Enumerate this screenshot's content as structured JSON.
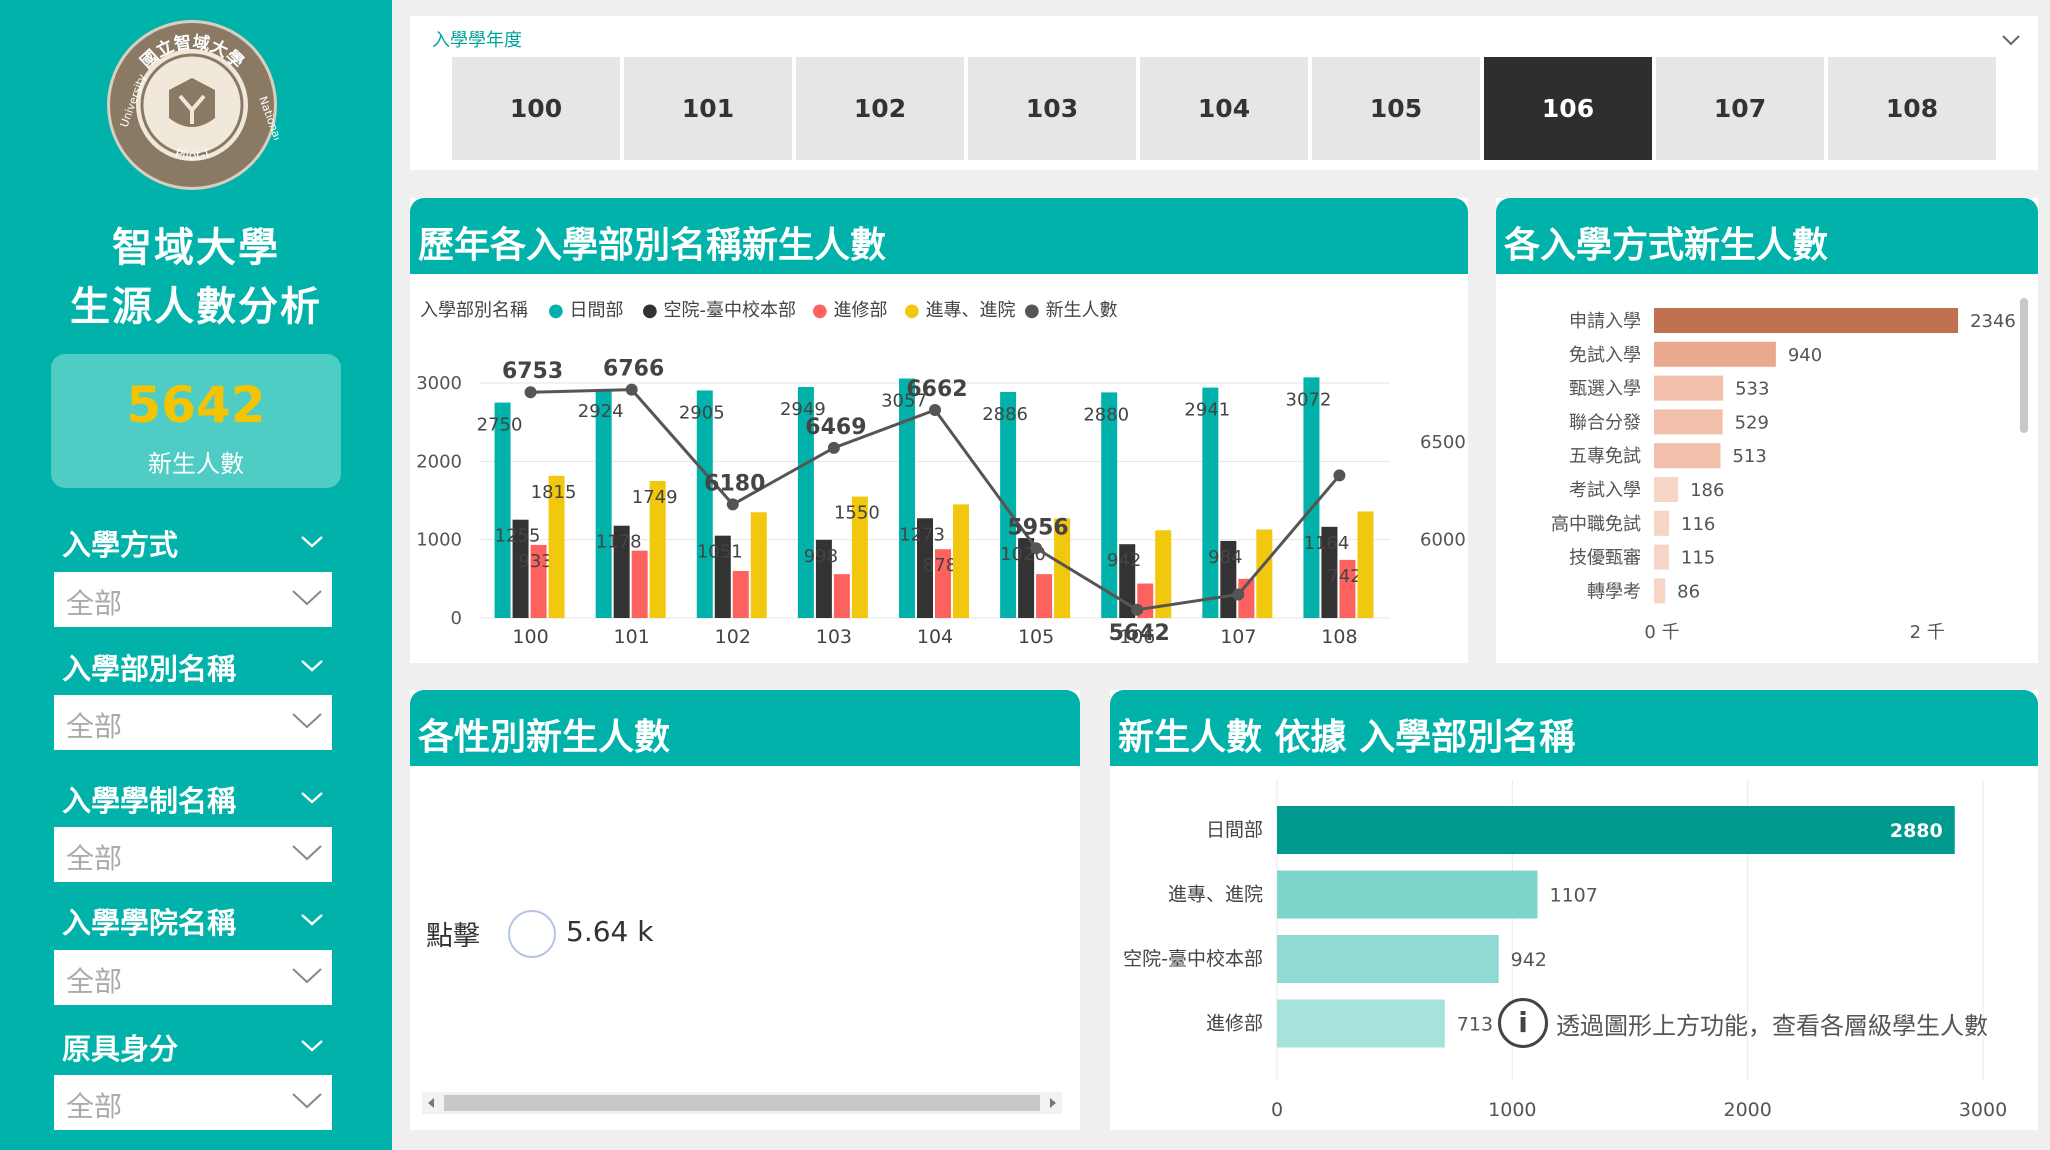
{
  "sidebar": {
    "logo": {
      "text_top": "國立智域大學",
      "text_right": "National",
      "text_left": "University",
      "text_bottom": "Pilot-I"
    },
    "title_line1": "智域大學",
    "title_line2": "生源人數分析",
    "kpi": {
      "value": "5642",
      "label": "新生人數"
    },
    "slicers": [
      {
        "label": "入學方式",
        "value": "全部"
      },
      {
        "label": "入學部別名稱",
        "value": "全部"
      },
      {
        "label": "入學學制名稱",
        "value": "全部"
      },
      {
        "label": "入學學院名稱",
        "value": "全部"
      },
      {
        "label": "原具身分",
        "value": "全部"
      }
    ],
    "colors": {
      "bg": "#00b2a9",
      "kpi_bg": "#4fcdc5",
      "kpi_value": "#f5c400"
    }
  },
  "year_slicer": {
    "label": "入學學年度",
    "years": [
      "100",
      "101",
      "102",
      "103",
      "104",
      "105",
      "106",
      "107",
      "108"
    ],
    "selected": "106"
  },
  "combo_chart": {
    "title": "歷年各入學部別名稱新生人數",
    "legend_title": "入學部別名稱",
    "legend": [
      {
        "name": "日間部",
        "color": "#00b2a9"
      },
      {
        "name": "空院-臺中校本部",
        "color": "#333333"
      },
      {
        "name": "進修部",
        "color": "#fd625e"
      },
      {
        "name": "進專、進院",
        "color": "#f2c80f"
      },
      {
        "name": "新生人數",
        "color": "#555555"
      }
    ],
    "x_labels": [
      "100",
      "101",
      "102",
      "103",
      "104",
      "105",
      "106",
      "107",
      "108"
    ],
    "left_ticks": [
      "0",
      "1000",
      "2000",
      "3000"
    ],
    "right_ticks": [
      "6000",
      "6500"
    ]
  },
  "chart_data": [
    {
      "type": "bar+line",
      "title": "歷年各入學部別名稱新生人數",
      "categories": [
        "100",
        "101",
        "102",
        "103",
        "104",
        "105",
        "106",
        "107",
        "108"
      ],
      "series": [
        {
          "name": "日間部",
          "values": [
            2750,
            2924,
            2905,
            2949,
            3057,
            2886,
            2880,
            2941,
            3072
          ]
        },
        {
          "name": "空院-臺中校本部",
          "values": [
            1255,
            1178,
            1051,
            998,
            1273,
            1020,
            942,
            984,
            1164
          ]
        },
        {
          "name": "進修部",
          "values": [
            933,
            860,
            600,
            560,
            878,
            560,
            440,
            500,
            742
          ]
        },
        {
          "name": "進專、進院",
          "values": [
            1815,
            1749,
            1350,
            1550,
            1450,
            1270,
            1120,
            1130,
            1360
          ]
        },
        {
          "name": "新生人數",
          "axis": "right",
          "values": [
            6753,
            6766,
            6180,
            6469,
            6662,
            5956,
            5642,
            5720,
            6328
          ]
        }
      ],
      "labeled_values": {
        "日間部": [
          "2750",
          "2924",
          "2905",
          "2949",
          "3057",
          "2886",
          "2880",
          "2941",
          "3072"
        ],
        "空院-臺中校本部": [
          "1255",
          "1178",
          "1051",
          "998",
          "1273",
          "1020",
          "942",
          "984",
          "1164"
        ],
        "進修部": [
          "933",
          "",
          "",
          "",
          "878",
          "",
          "",
          "",
          "742"
        ],
        "進專、進院": [
          "1815",
          "1749",
          "",
          "1550",
          "",
          "",
          "",
          "",
          ""
        ],
        "新生人數": [
          "6753",
          "6766",
          "6180",
          "6469",
          "6662",
          "5956",
          "5642",
          "",
          ""
        ]
      },
      "ylim": [
        0,
        3000
      ],
      "y2lim": [
        5600,
        6800
      ]
    },
    {
      "type": "bar",
      "orientation": "horizontal",
      "title": "各入學方式新生人數",
      "categories": [
        "申請入學",
        "免試入學",
        "甄選入學",
        "聯合分發",
        "五專免試",
        "考試入學",
        "高中職免試",
        "技優甄審",
        "轉學考"
      ],
      "values": [
        2346,
        940,
        533,
        529,
        513,
        186,
        116,
        115,
        86
      ],
      "x_ticks": [
        "0 千",
        "2 千"
      ],
      "xlim": [
        0,
        2600
      ]
    },
    {
      "type": "bar",
      "orientation": "horizontal",
      "title": "新生人數 依據 入學部別名稱",
      "categories": [
        "日間部",
        "進專、進院",
        "空院-臺中校本部",
        "進修部"
      ],
      "values": [
        2880,
        1107,
        942,
        713
      ],
      "x_ticks": [
        "0",
        "1000",
        "2000",
        "3000"
      ],
      "xlim": [
        0,
        3000
      ]
    }
  ],
  "method_chart": {
    "title": "各入學方式新生人數"
  },
  "gender_panel": {
    "title": "各性別新生人數",
    "click_label": "點擊",
    "value": "5.64 k"
  },
  "dept_chart": {
    "title": "新生人數 依據 入學部別名稱",
    "info_icon": "i",
    "info_text": "透過圖形上方功能，查看各層級學生人數"
  }
}
